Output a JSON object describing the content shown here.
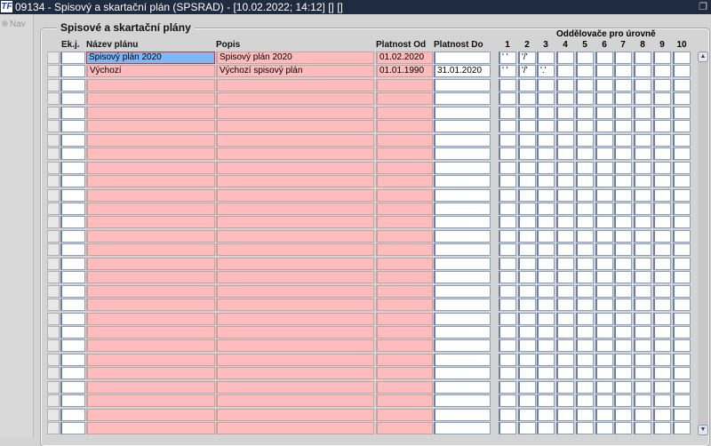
{
  "window": {
    "logo": "TF",
    "title": "09134 - Spisový a skartační plán (SPSRAD) - [10.02.2022; 14:12] [] []",
    "restore_icon": "restore-icon"
  },
  "nav": {
    "label": "Nav"
  },
  "group": {
    "title": "Spisové a skartační plány"
  },
  "columns": {
    "ekj": "Ek.j.",
    "nazev": "Název plánu",
    "popis": "Popis",
    "od": "Platnost Od",
    "do": "Platnost Do",
    "separators": "Oddělovače pro úrovně",
    "levels": [
      "1",
      "2",
      "3",
      "4",
      "5",
      "6",
      "7",
      "8",
      "9",
      "10"
    ]
  },
  "row_count": 28,
  "rows": [
    {
      "ekj": "",
      "nazev": "Spisový plán 2020",
      "popis": "Spisový plán 2020",
      "od": "01.02.2020",
      "do": "",
      "seps": [
        "' '",
        "'/'",
        "",
        "",
        "",
        "",
        "",
        "",
        "",
        ""
      ]
    },
    {
      "ekj": "",
      "nazev": "Výchozí",
      "popis": "Výchozí spisový plán",
      "od": "01.01.1990",
      "do": "31.01.2020",
      "seps": [
        "' '",
        "'/'",
        "'.'",
        "",
        "",
        "",
        "",
        "",
        "",
        ""
      ]
    }
  ]
}
